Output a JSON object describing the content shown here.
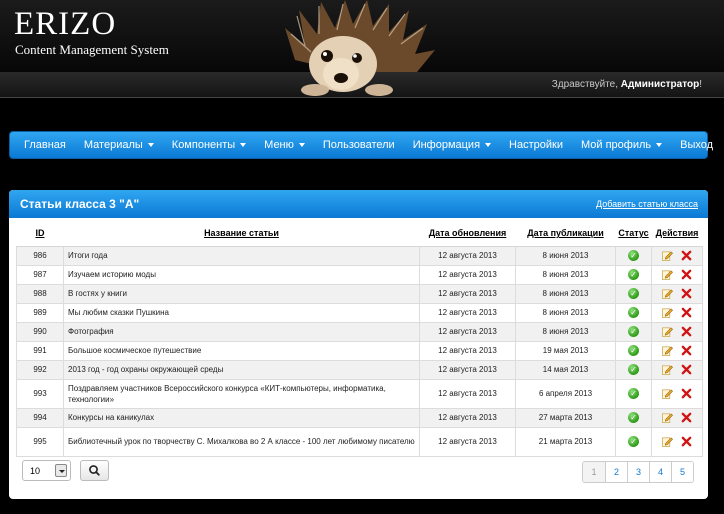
{
  "header": {
    "brand": "ERIZO",
    "subtitle": "Content Management System",
    "greeting": "Здравствуйте,",
    "user": "Администратор",
    "user_suffix": "!"
  },
  "nav": {
    "items": [
      {
        "label": "Главная",
        "dropdown": false
      },
      {
        "label": "Материалы",
        "dropdown": true
      },
      {
        "label": "Компоненты",
        "dropdown": true
      },
      {
        "label": "Меню",
        "dropdown": true
      },
      {
        "label": "Пользователи",
        "dropdown": false
      },
      {
        "label": "Информация",
        "dropdown": true
      },
      {
        "label": "Настройки",
        "dropdown": false
      },
      {
        "label": "Мой профиль",
        "dropdown": true
      },
      {
        "label": "Выход",
        "dropdown": false
      }
    ]
  },
  "panel": {
    "title": "Статьи класса 3 \"А\"",
    "add_link": "Добавить статью класса"
  },
  "table": {
    "headers": {
      "id": "ID",
      "title": "Название статьи",
      "updated": "Дата обновления",
      "published": "Дата публикации",
      "status": "Статус",
      "actions": "Действия"
    },
    "rows": [
      {
        "id": "986",
        "title": "Итоги года",
        "updated": "12 августа 2013",
        "published": "8 июня 2013"
      },
      {
        "id": "987",
        "title": "Изучаем историю моды",
        "updated": "12 августа 2013",
        "published": "8 июня 2013"
      },
      {
        "id": "988",
        "title": "В гостях у книги",
        "updated": "12 августа 2013",
        "published": "8 июня 2013"
      },
      {
        "id": "989",
        "title": "Мы любим сказки Пушкина",
        "updated": "12 августа 2013",
        "published": "8 июня 2013"
      },
      {
        "id": "990",
        "title": "Фотография",
        "updated": "12 августа 2013",
        "published": "8 июня 2013"
      },
      {
        "id": "991",
        "title": "Большое космическое путешествие",
        "updated": "12 августа 2013",
        "published": "19 мая 2013"
      },
      {
        "id": "992",
        "title": "2013 год - год охраны окружающей среды",
        "updated": "12 августа 2013",
        "published": "14 мая 2013"
      },
      {
        "id": "993",
        "title": "Поздравляем участников Всероссийского конкурса «КИТ-компьютеры, информатика, технологии»",
        "updated": "12 августа 2013",
        "published": "6 апреля 2013"
      },
      {
        "id": "994",
        "title": "Конкурсы на каникулах",
        "updated": "12 августа 2013",
        "published": "27 марта 2013"
      },
      {
        "id": "995",
        "title": "Библиотечный урок по творчеству С. Михалкова во 2 А классе - 100 лет любимому писателю",
        "updated": "12 августа 2013",
        "published": "21 марта 2013"
      }
    ]
  },
  "footer": {
    "per_page": "10",
    "pages": [
      "1",
      "2",
      "3",
      "4",
      "5"
    ],
    "active_page": "1"
  },
  "colors": {
    "accent": "#0b79d4",
    "status_ok": "#2f9a18",
    "delete": "#d01414"
  },
  "icons": {
    "status": "check-circle-icon",
    "edit": "pencil-icon",
    "delete": "delete-x-icon",
    "search": "search-icon"
  }
}
